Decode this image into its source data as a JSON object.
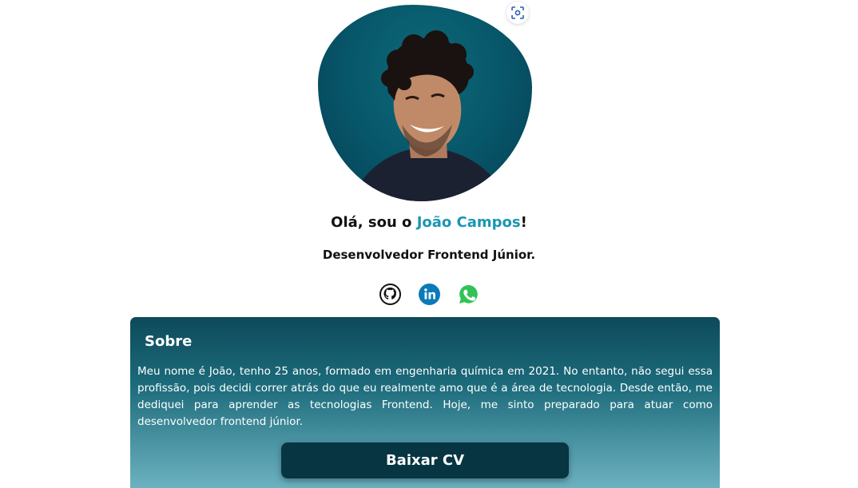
{
  "hero": {
    "greeting_prefix": "Olá, sou o ",
    "name": "João Campos",
    "greeting_suffix": "!",
    "role": "Desenvolvedor Frontend Júnior."
  },
  "socials": [
    {
      "icon": "github-icon"
    },
    {
      "icon": "linkedin-icon"
    },
    {
      "icon": "whatsapp-icon"
    }
  ],
  "about": {
    "title": "Sobre",
    "text": "Meu nome é João, tenho 25 anos, formado em engenharia química em 2021. No entanto, não segui essa profissão, pois decidi correr atrás do que eu realmente amo que é a área de tecnologia. Desde então, me dediquei para aprender as tecnologias Frontend. Hoje, me sinto preparado para atuar como desenvolvedor frontend júnior.",
    "cv_button": "Baixar CV"
  },
  "colors": {
    "accent": "#1b96b3",
    "button": "#073542"
  }
}
